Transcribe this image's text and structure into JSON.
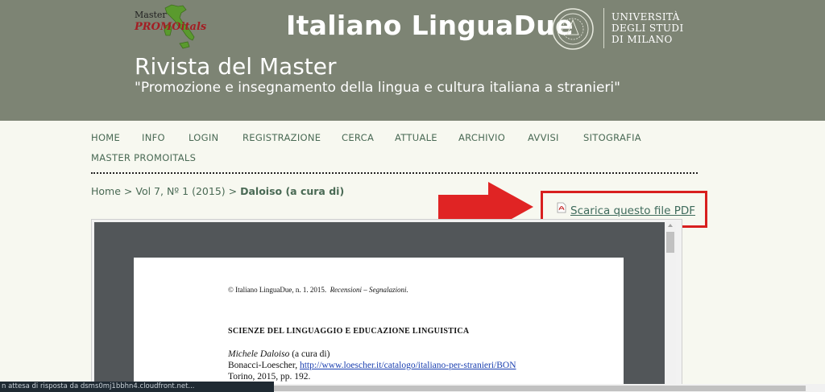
{
  "header": {
    "logo_master": "Master",
    "logo_promo": "PROMOitals",
    "site_title": "Italiano LinguaDue",
    "university_lines": [
      "UNIVERSITÀ",
      "DEGLI STUDI",
      "DI MILANO"
    ],
    "rivista_title": "Rivista del Master",
    "rivista_subtitle": "\"Promozione e insegnamento della lingua e cultura italiana a stranieri\""
  },
  "nav": {
    "items": [
      "HOME",
      "INFO",
      "LOGIN",
      "REGISTRAZIONE",
      "CERCA",
      "ATTUALE",
      "ARCHIVIO",
      "AVVISI",
      "SITOGRAFIA",
      "MASTER PROMOITALS"
    ]
  },
  "breadcrumb": {
    "home": "Home",
    "sep": ">",
    "issue": "Vol 7, Nº 1 (2015)",
    "current": "Daloiso (a cura di)"
  },
  "pdf": {
    "download_label": "Scarica questo file PDF"
  },
  "document": {
    "header_text": "© Italiano LinguaDue, n. 1. 2015.",
    "header_italic": "Recensioni – Segnalazioni.",
    "section_title": "SCIENZE DEL LINGUAGGIO E EDUCAZIONE LINGUISTICA",
    "author_italic": "Michele Daloiso",
    "author_suffix": " (a cura di)",
    "publisher": "Bonacci-Loescher, ",
    "link": "http://www.loescher.it/catalogo/italiano-per-stranieri/BON",
    "place": "Torino, 2015, pp. 192."
  },
  "status_bar": {
    "text": "n attesa di risposta da dsms0mj1bbhn4.cloudfront.net..."
  },
  "colors": {
    "header_bg": "#7d8474",
    "page_bg": "#f7f8f0",
    "link_green": "#4a6a55",
    "highlight_red": "#d81f1f"
  }
}
